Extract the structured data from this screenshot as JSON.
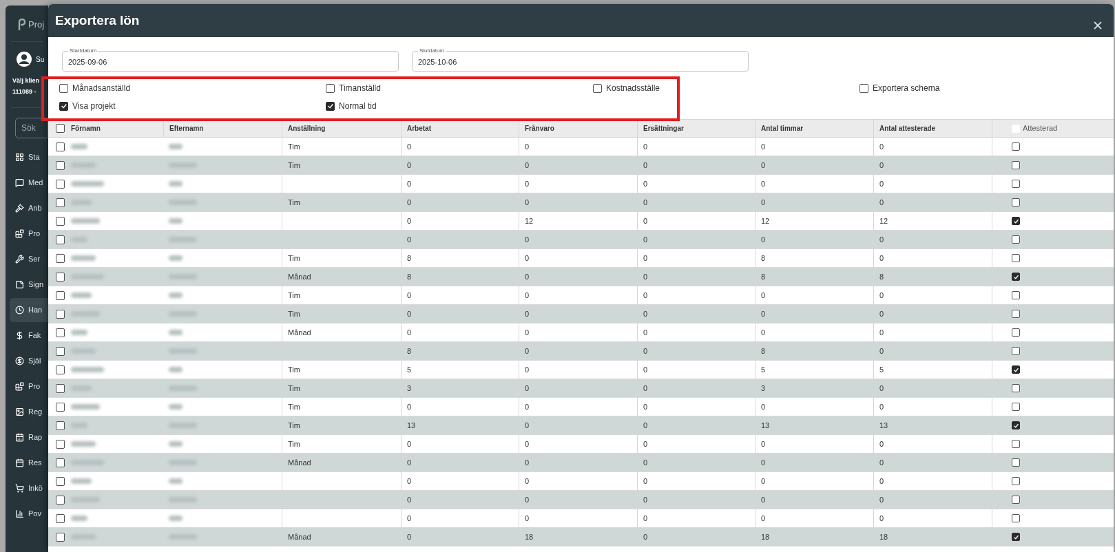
{
  "sidebar": {
    "logo_text": "Proj",
    "user_text": "Su",
    "client_label": "Välj klien",
    "client_value": "111089 -",
    "search_placeholder": "Sök",
    "items": [
      {
        "label": "Sta",
        "selected": false
      },
      {
        "label": "Med",
        "selected": false
      },
      {
        "label": "Anb",
        "selected": false
      },
      {
        "label": "Pro",
        "selected": false
      },
      {
        "label": "Ser",
        "selected": false
      },
      {
        "label": "Sign",
        "selected": false
      },
      {
        "label": "Han",
        "selected": true
      },
      {
        "label": "Fak",
        "selected": false
      },
      {
        "label": "Själ",
        "selected": false
      },
      {
        "label": "Pro",
        "selected": false
      },
      {
        "label": "Reg",
        "selected": false
      },
      {
        "label": "Rap",
        "selected": false
      },
      {
        "label": "Res",
        "selected": false
      },
      {
        "label": "Inkö",
        "selected": false
      },
      {
        "label": "Pov",
        "selected": false
      }
    ]
  },
  "modal": {
    "title": "Exportera lön",
    "fields": [
      {
        "label": "Startdatum",
        "value": "2025-09-06"
      },
      {
        "label": "Slutdatum",
        "value": "2025-10-06"
      }
    ],
    "highlighted_options": [
      {
        "label": "Månadsanställd",
        "checked": false
      },
      {
        "label": "Timanställd",
        "checked": false
      },
      {
        "label": "Kostnadsställe",
        "checked": false
      },
      {
        "label": "Visa projekt",
        "checked": true
      },
      {
        "label": "Normal tid",
        "checked": true
      }
    ],
    "other_options": [
      {
        "label": "Exportera schema",
        "checked": false
      }
    ],
    "table": {
      "select_all": false,
      "columns": [
        "Förnamn",
        "Efternamn",
        "Anställning",
        "Arbetat",
        "Frånvaro",
        "Ersättningar",
        "Antal timmar",
        "Antal attesterade",
        "Attesterad"
      ],
      "rows": [
        {
          "selected": false,
          "employment": "Tim",
          "worked": "0",
          "absence": "0",
          "compensation": "0",
          "hours": "0",
          "attested_hours": "0",
          "attested": false
        },
        {
          "selected": false,
          "employment": "Tim",
          "worked": "0",
          "absence": "0",
          "compensation": "0",
          "hours": "0",
          "attested_hours": "0",
          "attested": false
        },
        {
          "selected": false,
          "worked": "0",
          "absence": "0",
          "compensation": "0",
          "hours": "0",
          "attested_hours": "0",
          "attested": false
        },
        {
          "selected": false,
          "employment": "Tim",
          "worked": "0",
          "absence": "0",
          "compensation": "0",
          "hours": "0",
          "attested_hours": "0",
          "attested": false
        },
        {
          "selected": false,
          "worked": "0",
          "absence": "12",
          "compensation": "0",
          "hours": "12",
          "attested_hours": "12",
          "attested": true
        },
        {
          "selected": false,
          "worked": "0",
          "absence": "0",
          "compensation": "0",
          "hours": "0",
          "attested_hours": "0",
          "attested": false
        },
        {
          "selected": false,
          "employment": "Tim",
          "worked": "8",
          "absence": "0",
          "compensation": "0",
          "hours": "8",
          "attested_hours": "0",
          "attested": false
        },
        {
          "selected": false,
          "employment": "Månad",
          "worked": "8",
          "absence": "0",
          "compensation": "0",
          "hours": "8",
          "attested_hours": "8",
          "attested": true
        },
        {
          "selected": false,
          "employment": "Tim",
          "worked": "0",
          "absence": "0",
          "compensation": "0",
          "hours": "0",
          "attested_hours": "0",
          "attested": false
        },
        {
          "selected": false,
          "employment": "Tim",
          "worked": "0",
          "absence": "0",
          "compensation": "0",
          "hours": "0",
          "attested_hours": "0",
          "attested": false
        },
        {
          "selected": false,
          "employment": "Månad",
          "worked": "0",
          "absence": "0",
          "compensation": "0",
          "hours": "0",
          "attested_hours": "0",
          "attested": false
        },
        {
          "selected": false,
          "worked": "8",
          "absence": "0",
          "compensation": "0",
          "hours": "8",
          "attested_hours": "0",
          "attested": false
        },
        {
          "selected": false,
          "employment": "Tim",
          "worked": "5",
          "absence": "0",
          "compensation": "0",
          "hours": "5",
          "attested_hours": "5",
          "attested": true
        },
        {
          "selected": false,
          "employment": "Tim",
          "worked": "3",
          "absence": "0",
          "compensation": "0",
          "hours": "3",
          "attested_hours": "0",
          "attested": false
        },
        {
          "selected": false,
          "employment": "Tim",
          "worked": "0",
          "absence": "0",
          "compensation": "0",
          "hours": "0",
          "attested_hours": "0",
          "attested": false
        },
        {
          "selected": false,
          "employment": "Tim",
          "worked": "13",
          "absence": "0",
          "compensation": "0",
          "hours": "13",
          "attested_hours": "13",
          "attested": true
        },
        {
          "selected": false,
          "employment": "Tim",
          "worked": "0",
          "absence": "0",
          "compensation": "0",
          "hours": "0",
          "attested_hours": "0",
          "attested": false
        },
        {
          "selected": false,
          "employment": "Månad",
          "worked": "0",
          "absence": "0",
          "compensation": "0",
          "hours": "0",
          "attested_hours": "0",
          "attested": false
        },
        {
          "selected": false,
          "worked": "0",
          "absence": "0",
          "compensation": "0",
          "hours": "0",
          "attested_hours": "0",
          "attested": false
        },
        {
          "selected": false,
          "worked": "0",
          "absence": "0",
          "compensation": "0",
          "hours": "0",
          "attested_hours": "0",
          "attested": false
        },
        {
          "selected": false,
          "worked": "0",
          "absence": "0",
          "compensation": "0",
          "hours": "0",
          "attested_hours": "0",
          "attested": false
        },
        {
          "selected": false,
          "employment": "Månad",
          "worked": "0",
          "absence": "18",
          "compensation": "0",
          "hours": "18",
          "attested_hours": "18",
          "attested": true
        }
      ]
    }
  }
}
